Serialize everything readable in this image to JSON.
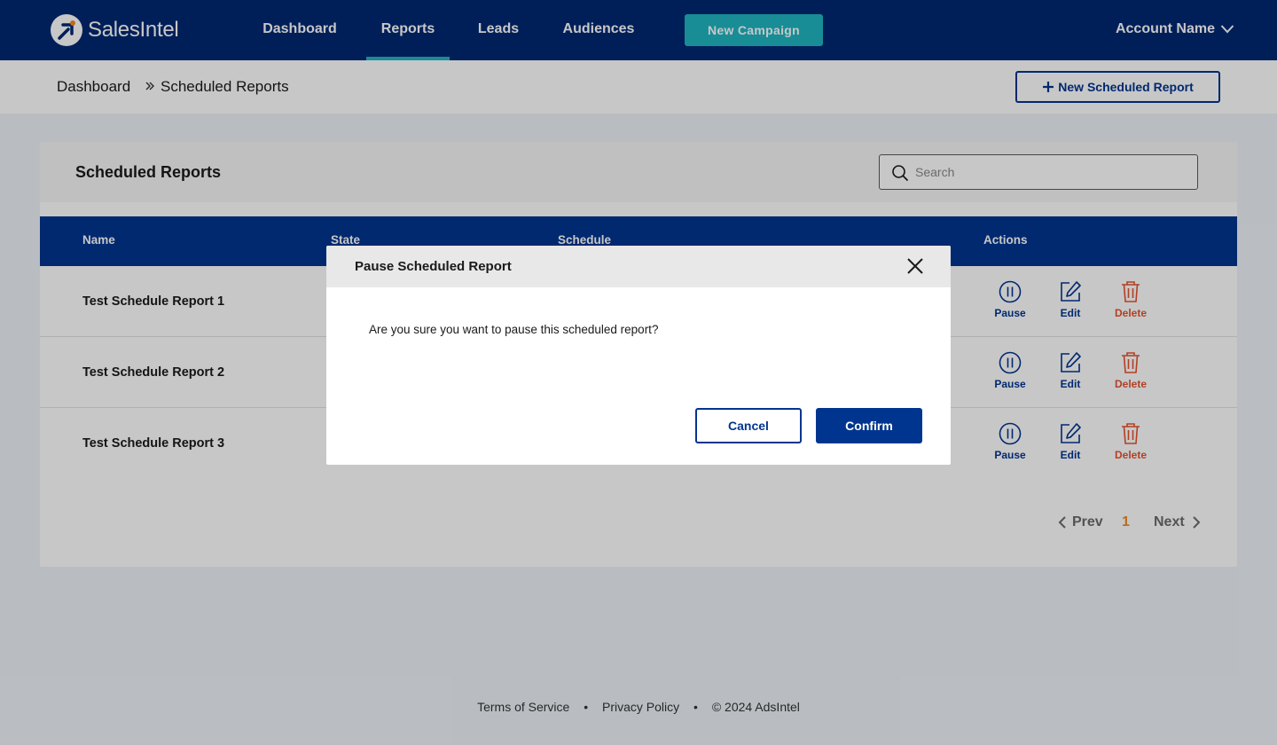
{
  "brand": {
    "name": "SalesIntel",
    "colors": {
      "navy": "#002872",
      "primary": "#00358f",
      "teal": "#1fb5c1",
      "danger": "#e4532f",
      "accent": "#f08a26"
    }
  },
  "nav": {
    "items": [
      {
        "label": "Dashboard",
        "active": false
      },
      {
        "label": "Reports",
        "active": true
      },
      {
        "label": "Leads",
        "active": false
      },
      {
        "label": "Audiences",
        "active": false
      }
    ],
    "new_campaign_label": "New Campaign",
    "account_label": "Account Name",
    "account_icon": "chevron-down-icon"
  },
  "breadcrumb": {
    "items": [
      "Dashboard",
      "Scheduled Reports"
    ],
    "separator_icon": "double-chevron-right-icon"
  },
  "new_scheduled_report_label": "New Scheduled Report",
  "card": {
    "title": "Scheduled Reports",
    "search": {
      "placeholder": "Search",
      "value": "",
      "icon": "search-icon"
    },
    "columns": [
      "Name",
      "State",
      "Schedule",
      "Actions"
    ],
    "rows": [
      {
        "name": "Test Schedule Report 1"
      },
      {
        "name": "Test Schedule Report 2"
      },
      {
        "name": "Test Schedule Report 3"
      }
    ],
    "actions": {
      "pause": "Pause",
      "edit": "Edit",
      "delete": "Delete"
    },
    "pager": {
      "prev": "Prev",
      "current": "1",
      "next": "Next"
    }
  },
  "footer": {
    "terms": "Terms of Service",
    "privacy": "Privacy Policy",
    "copyright": "© 2024 AdsIntel",
    "separator": "•"
  },
  "modal": {
    "title": "Pause Scheduled Report",
    "message": "Are you sure you want to pause this scheduled report?",
    "cancel_label": "Cancel",
    "confirm_label": "Confirm",
    "close_icon": "close-icon"
  }
}
